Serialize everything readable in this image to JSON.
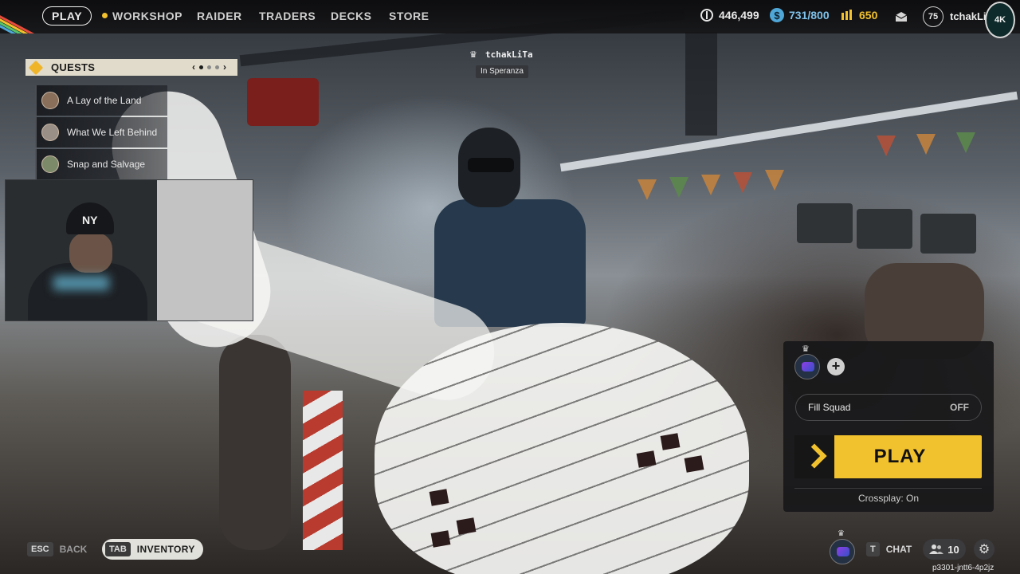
{
  "nav": {
    "play": "PLAY",
    "workshop": "WORKSHOP",
    "raider": "RAIDER",
    "traders": "TRADERS",
    "decks": "DECKS",
    "store": "STORE"
  },
  "resources": {
    "currency": "446,499",
    "coins": "731/800",
    "credits": "650"
  },
  "profile": {
    "level": "75",
    "username": "tchakLiT",
    "emblem_text": "4K"
  },
  "quests": {
    "title": "QUESTS",
    "prev": "‹",
    "next": "›",
    "items": [
      {
        "label": "A Lay of the Land"
      },
      {
        "label": "What We Left Behind"
      },
      {
        "label": "Snap and Salvage"
      }
    ]
  },
  "player_tag": {
    "name": "tchakLiTa",
    "location": "In Speranza"
  },
  "lobby": {
    "add": "+",
    "fill_squad_label": "Fill Squad",
    "fill_squad_value": "OFF",
    "play_label": "PLAY",
    "crossplay": "Crossplay: On"
  },
  "bottom": {
    "esc_key": "ESC",
    "back_label": "BACK",
    "tab_key": "TAB",
    "inventory_label": "INVENTORY",
    "chat_key": "T",
    "chat_label": "CHAT",
    "friends_count": "10",
    "session_id": "p3301-jntt6-4p2jz"
  },
  "colors": {
    "accent": "#f2c12e",
    "panel": "#161618"
  },
  "icons": [
    "crown-icon",
    "currency-icon",
    "coin-icon",
    "credits-icon",
    "mail-icon",
    "quests-icon",
    "gear-icon",
    "friends-icon",
    "chevron-icon"
  ]
}
